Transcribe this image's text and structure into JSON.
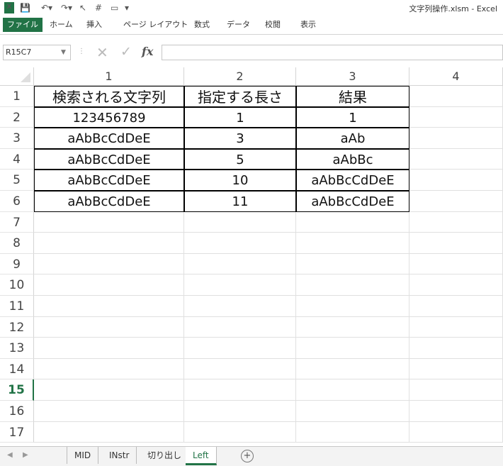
{
  "window": {
    "title": "文字列操作.xlsm - Excel"
  },
  "ribbon": {
    "tabs": [
      "ファイル",
      "ホーム",
      "挿入",
      "ページ レイアウト",
      "数式",
      "データ",
      "校閲",
      "表示"
    ]
  },
  "formula_bar": {
    "name_box": "R15C7",
    "formula": ""
  },
  "columns": [
    "1",
    "2",
    "3",
    "4"
  ],
  "rows": [
    "1",
    "2",
    "3",
    "4",
    "5",
    "6",
    "7",
    "8",
    "9",
    "10",
    "11",
    "12",
    "13",
    "14",
    "15",
    "16",
    "17"
  ],
  "selected_row": "15",
  "table": {
    "headers": [
      "検索される文字列",
      "指定する長さ",
      "結果"
    ],
    "data": [
      [
        "123456789",
        "1",
        "1"
      ],
      [
        "aAbBcCdDeE",
        "3",
        "aAb"
      ],
      [
        "aAbBcCdDeE",
        "5",
        "aAbBc"
      ],
      [
        "aAbBcCdDeE",
        "10",
        "aAbBcCdDeE"
      ],
      [
        "aAbBcCdDeE",
        "11",
        "aAbBcCdDeE"
      ]
    ]
  },
  "sheet_tabs": [
    "MID",
    "INstr",
    "切り出し",
    "Left"
  ],
  "active_sheet": "Left",
  "colors": {
    "accent": "#217346"
  }
}
